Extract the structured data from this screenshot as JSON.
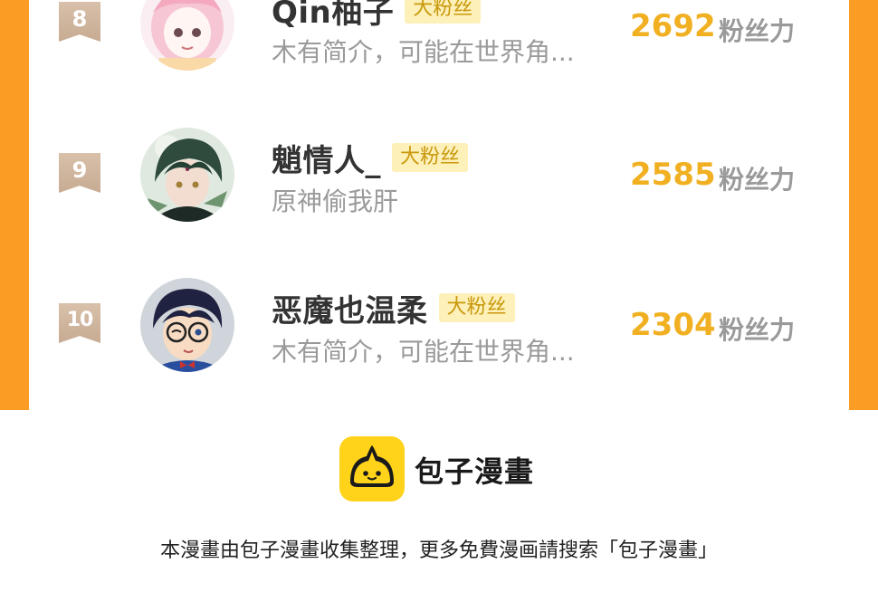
{
  "ranking": [
    {
      "rank": "8",
      "name": "Qin柚子",
      "badge": "大粉丝",
      "bio": "木有简介，可能在世界角...",
      "score": "2692",
      "unit": "粉丝力",
      "avatar": "pink-hair-girl-avatar"
    },
    {
      "rank": "9",
      "name": "魈情人_",
      "badge": "大粉丝",
      "bio": "原神偷我肝",
      "score": "2585",
      "unit": "粉丝力",
      "avatar": "green-hair-boy-avatar"
    },
    {
      "rank": "10",
      "name": "恶魔也温柔",
      "badge": "大粉丝",
      "bio": "木有简介，可能在世界角...",
      "score": "2304",
      "unit": "粉丝力",
      "avatar": "glasses-boy-avatar"
    }
  ],
  "footer": {
    "brand": "包子漫畫",
    "note": "本漫畫由包子漫畫收集整理，更多免費漫画請搜索「包子漫畫」"
  },
  "colors": {
    "frame": "#fb9d24",
    "score": "#f1b022",
    "badge_bg": "#fdf0b8",
    "logo": "#ffd31a"
  }
}
